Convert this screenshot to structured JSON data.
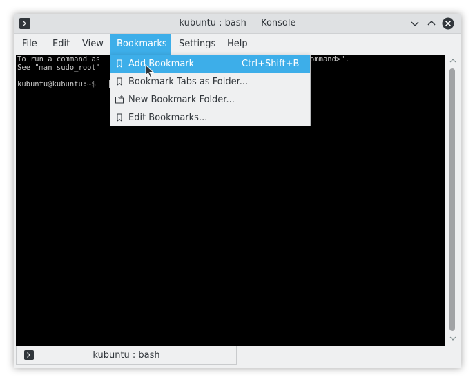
{
  "window": {
    "title": "kubuntu : bash — Konsole"
  },
  "menubar": {
    "items": [
      {
        "label": "File"
      },
      {
        "label": "Edit"
      },
      {
        "label": "View"
      },
      {
        "label": "Bookmarks",
        "active": true
      },
      {
        "label": "Settings"
      },
      {
        "label": "Help"
      }
    ]
  },
  "terminal": {
    "lines": [
      "To run a command as",
      "See \"man sudo_root\"",
      "",
      "kubuntu@kubuntu:~$"
    ],
    "line1_tail": "ommand>\"."
  },
  "bookmarks_menu": {
    "items": [
      {
        "label": "Add Bookmark",
        "shortcut": "Ctrl+Shift+B",
        "icon": "bookmark-icon",
        "highlighted": true
      },
      {
        "label": "Bookmark Tabs as Folder...",
        "shortcut": "",
        "icon": "bookmark-icon"
      },
      {
        "label": "New Bookmark Folder...",
        "shortcut": "",
        "icon": "folder-new-icon"
      },
      {
        "label": "Edit Bookmarks...",
        "shortcut": "",
        "icon": "bookmark-icon"
      }
    ]
  },
  "tabs": [
    {
      "label": "kubuntu : bash",
      "icon": "terminal-icon"
    }
  ],
  "colors": {
    "accent": "#3daee9",
    "terminal_bg": "#000000",
    "terminal_fg": "#c8c8c8",
    "window_bg": "#eff0f1",
    "text": "#31363b"
  }
}
